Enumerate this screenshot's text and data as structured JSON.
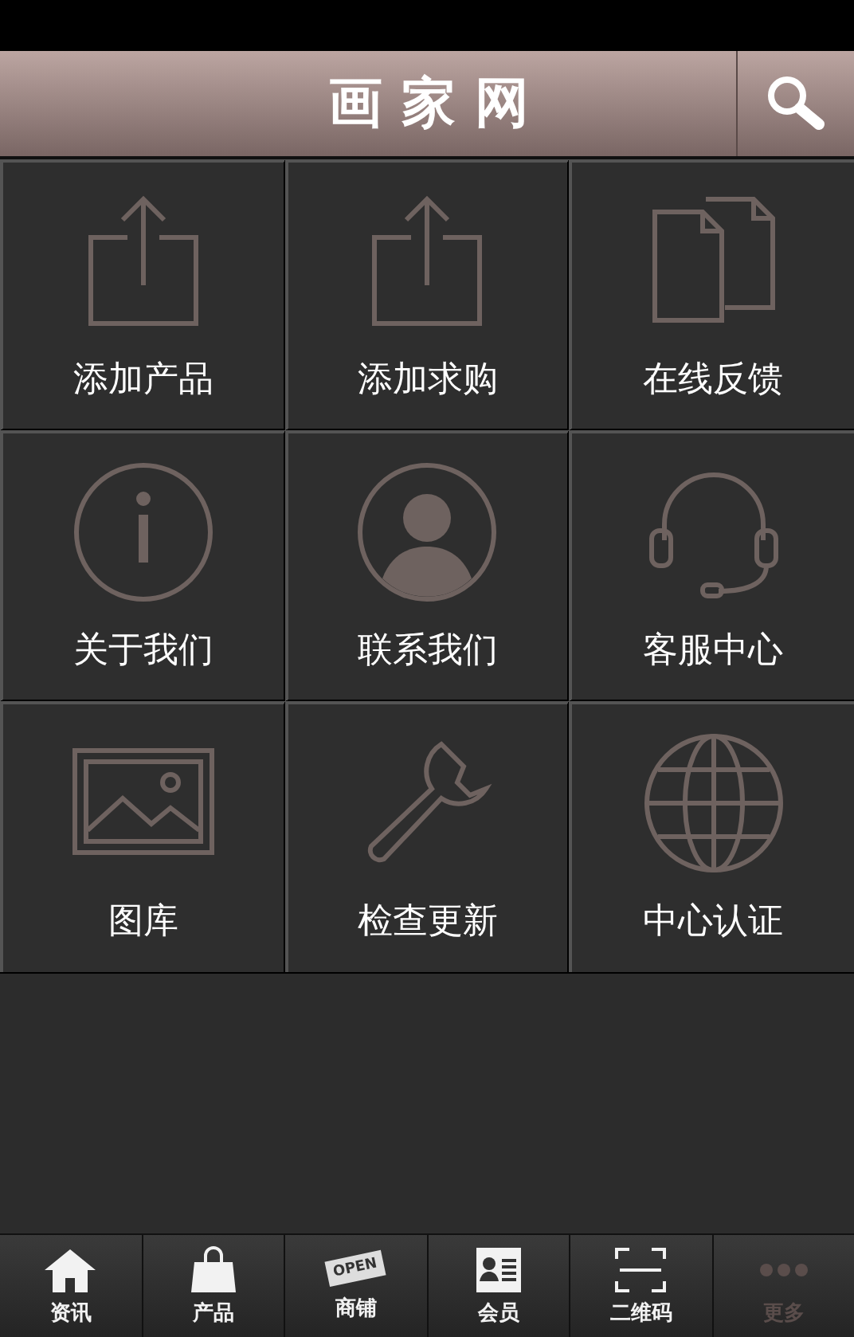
{
  "header": {
    "title": "画 家 网"
  },
  "grid": [
    {
      "kind": "upload",
      "label": "添加产品"
    },
    {
      "kind": "upload",
      "label": "添加求购"
    },
    {
      "kind": "copy",
      "label": "在线反馈"
    },
    {
      "kind": "info",
      "label": "关于我们"
    },
    {
      "kind": "person",
      "label": "联系我们"
    },
    {
      "kind": "headset",
      "label": "客服中心"
    },
    {
      "kind": "image",
      "label": "图库"
    },
    {
      "kind": "wrench",
      "label": "检查更新"
    },
    {
      "kind": "globe",
      "label": "中心认证"
    }
  ],
  "tab_bar": [
    {
      "kind": "home",
      "label": "资讯",
      "disabled": false
    },
    {
      "kind": "bag",
      "label": "产品",
      "disabled": false
    },
    {
      "kind": "sign",
      "label": "商铺",
      "sign_text": "OPEN",
      "disabled": false
    },
    {
      "kind": "card",
      "label": "会员",
      "disabled": false
    },
    {
      "kind": "scan",
      "label": "二维码",
      "disabled": false
    },
    {
      "kind": "dots",
      "label": "更多",
      "disabled": true
    }
  ]
}
